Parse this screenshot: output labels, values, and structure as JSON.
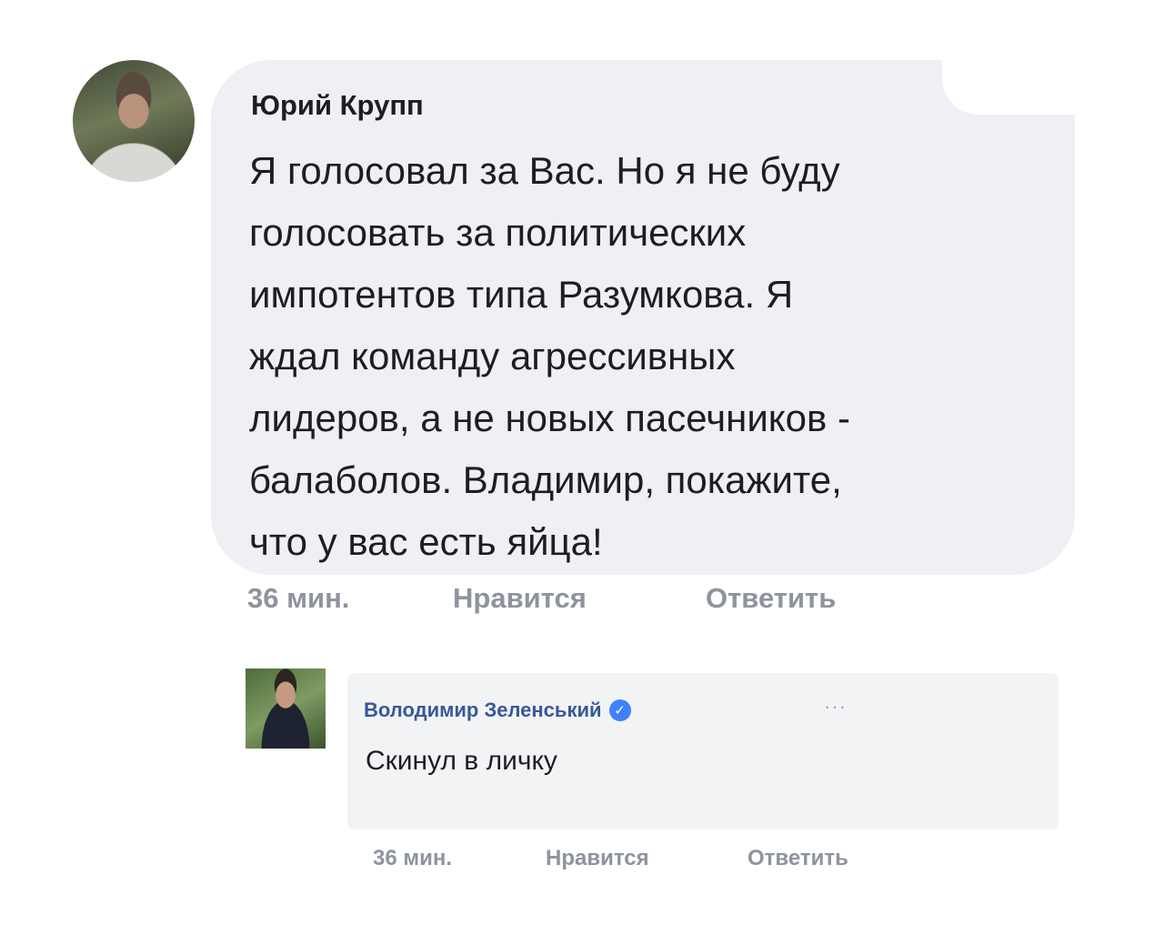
{
  "comment1": {
    "author": "Юрий Крупп",
    "lines": [
      "Я голосовал за Вас. Но я не буду",
      "голосовать за политических",
      "импотентов типа Разумкова. Я",
      "ждал команду агрессивных",
      "лидеров, а не новых пасечников -",
      "балаболов. Владимир, покажите,",
      "что у вас есть яйца!"
    ],
    "time": "36 мин.",
    "like_label": "Нравится",
    "reply_label": "Ответить"
  },
  "comment2": {
    "author": "Володимир Зеленський",
    "verified_icon": "verified-badge-icon",
    "more_label": "···",
    "text": "Скинул в личку",
    "time": "36 мин.",
    "like_label": "Нравится",
    "reply_label": "Ответить"
  },
  "colors": {
    "bubble": "#eef0f3",
    "author2_link": "#385898",
    "meta_gray": "#8d949e",
    "verified": "#4080ff"
  }
}
